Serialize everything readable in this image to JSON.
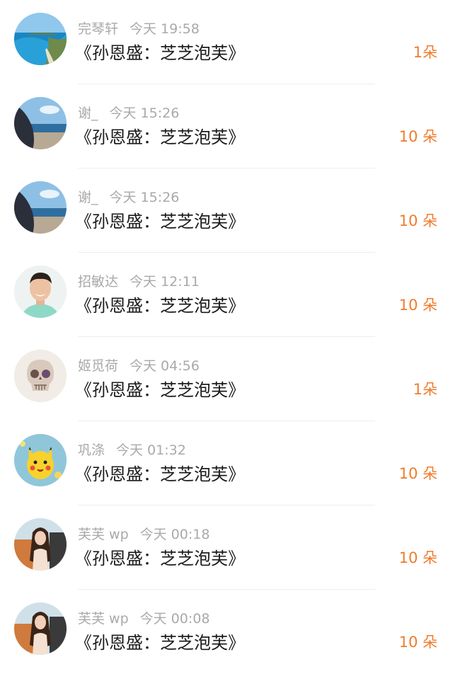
{
  "rows": [
    {
      "user": "完琴轩",
      "time": "今天 19:58",
      "title": "《孙恩盛：芝芝泡芙》",
      "count": "1朵",
      "avatar": "coast-bay-avatar"
    },
    {
      "user": "谢_",
      "time": "今天 15:26",
      "title": "《孙恩盛：芝芝泡芙》",
      "count": "10 朵",
      "avatar": "beach-silhouette-avatar"
    },
    {
      "user": "谢_",
      "time": "今天 15:26",
      "title": "《孙恩盛：芝芝泡芙》",
      "count": "10 朵",
      "avatar": "beach-silhouette-avatar"
    },
    {
      "user": "招敏达",
      "time": "今天 12:11",
      "title": "《孙恩盛：芝芝泡芙》",
      "count": "10 朵",
      "avatar": "smiling-man-avatar"
    },
    {
      "user": "姬觅荷",
      "time": "今天 04:56",
      "title": "《孙恩盛：芝芝泡芙》",
      "count": "1朵",
      "avatar": "skull-avatar"
    },
    {
      "user": "巩涤",
      "time": "今天 01:32",
      "title": "《孙恩盛：芝芝泡芙》",
      "count": "10 朵",
      "avatar": "pikachu-avatar"
    },
    {
      "user": "芙芙 wp",
      "time": "今天 00:18",
      "title": "《孙恩盛：芝芝泡芙》",
      "count": "10 朵",
      "avatar": "girl-car-avatar"
    },
    {
      "user": "芙芙 wp",
      "time": "今天 00:08",
      "title": "《孙恩盛：芝芝泡芙》",
      "count": "10 朵",
      "avatar": "girl-car-avatar"
    }
  ],
  "colors": {
    "count_accent": "#f07b2c",
    "meta_gray": "#a9a9a9",
    "title_text": "#1c1c1c"
  }
}
